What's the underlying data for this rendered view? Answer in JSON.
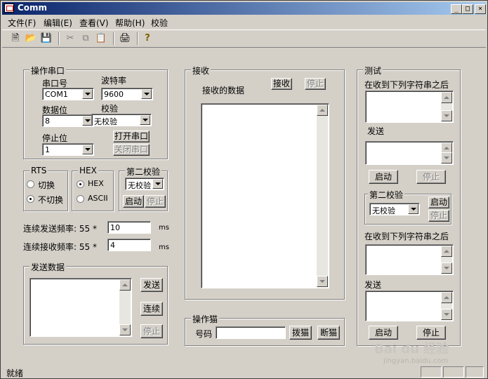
{
  "window": {
    "title": "Comm",
    "buttons": {
      "minimize": "_",
      "maximize": "□",
      "close": "×"
    }
  },
  "menu": [
    "文件(F)",
    "编辑(E)",
    "查看(V)",
    "帮助(H)",
    "校验"
  ],
  "toolbar": {
    "icons": [
      "new-file-icon",
      "open-folder-icon",
      "save-icon",
      "cut-icon",
      "copy-icon",
      "paste-icon",
      "print-icon",
      "help-icon"
    ]
  },
  "serial": {
    "title": "操作串口",
    "port_label": "串口号",
    "port_value": "COM1",
    "baud_label": "波特率",
    "baud_value": "9600",
    "databits_label": "数据位",
    "databits_value": "8",
    "parity_label": "校验",
    "parity_value": "无校验",
    "stopbits_label": "停止位",
    "stopbits_value": "1",
    "open_btn": "打开串口",
    "close_btn": "关闭串口"
  },
  "rts": {
    "title": "RTS",
    "opt1": "切换",
    "opt2": "不切换",
    "selected": "不切换"
  },
  "hex": {
    "title": "HEX",
    "opt1": "HEX",
    "opt2": "ASCII",
    "selected": "HEX"
  },
  "check2": {
    "title": "第二校验",
    "value": "无校验",
    "start": "启动",
    "stop": "停止"
  },
  "freq": {
    "send_label": "连续发送频率: 55 *",
    "send_value": "10",
    "send_unit": "ms",
    "recv_label": "连续接收频率: 55 *",
    "recv_value": "4",
    "recv_unit": "ms"
  },
  "send": {
    "title": "发送数据",
    "send_btn": "发送",
    "continuous_btn": "连续",
    "stop_btn": "停止"
  },
  "receive": {
    "title": "接收",
    "data_label": "接收的数据",
    "recv_btn": "接收",
    "stop_btn": "停止"
  },
  "modem": {
    "title": "操作猫",
    "number_label": "号码",
    "number_value": "",
    "dial_btn": "拨猫",
    "hangup_btn": "断猫"
  },
  "test": {
    "title": "测试",
    "trigger1_label": "在收到下列字符串之后",
    "send1_label": "发送",
    "start1": "启动",
    "stop1": "停止",
    "check_title": "第二校验",
    "check_value": "无校验",
    "check_start": "启动",
    "check_stop": "停止",
    "trigger2_label": "在收到下列字符串之后",
    "send2_label": "发送",
    "start2": "启动",
    "stop2": "停止"
  },
  "status": {
    "text": "就绪"
  },
  "watermark": {
    "brand": "Bai du 经验",
    "url": "jingyan.baidu.com"
  }
}
